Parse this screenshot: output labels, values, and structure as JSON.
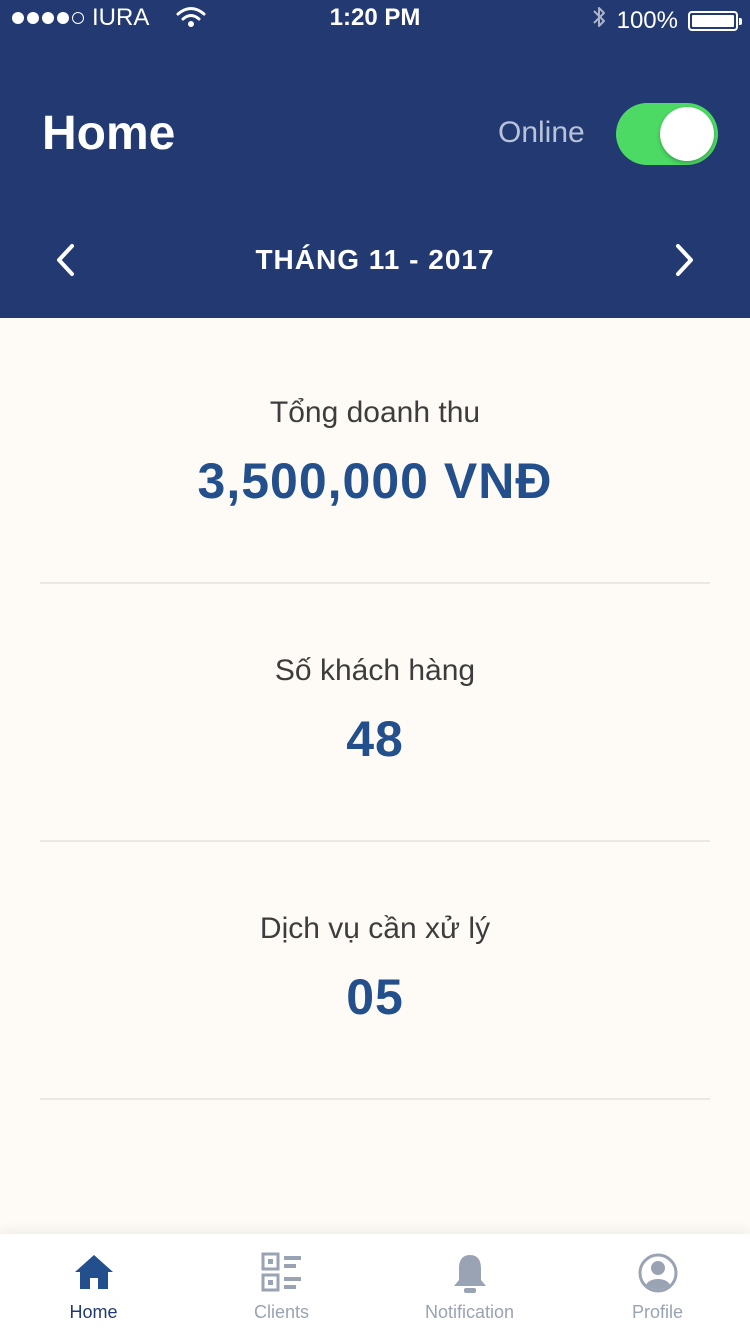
{
  "status_bar": {
    "carrier": "IURA",
    "time": "1:20 PM",
    "battery": "100%",
    "battery_level": 1.0
  },
  "header": {
    "title": "Home",
    "online_label": "Online",
    "online_enabled": true,
    "month": "THÁNG 11 - 2017"
  },
  "stats": [
    {
      "label": "Tổng doanh thu",
      "value": "3,500,000 VNĐ"
    },
    {
      "label": "Số khách hàng",
      "value": "48"
    },
    {
      "label": "Dịch vụ cần xử lý",
      "value": "05"
    }
  ],
  "tabs": [
    {
      "label": "Home",
      "icon": "home-icon",
      "active": true
    },
    {
      "label": "Clients",
      "icon": "qr-code-icon",
      "active": false
    },
    {
      "label": "Notification",
      "icon": "bell-icon",
      "active": false
    },
    {
      "label": "Profile",
      "icon": "profile-icon",
      "active": false
    }
  ],
  "colors": {
    "header": "#223971",
    "accent_value": "#234f8c",
    "toggle_on": "#4cd964",
    "background": "#fefbf6",
    "tab_inactive": "#9aa3b3"
  }
}
